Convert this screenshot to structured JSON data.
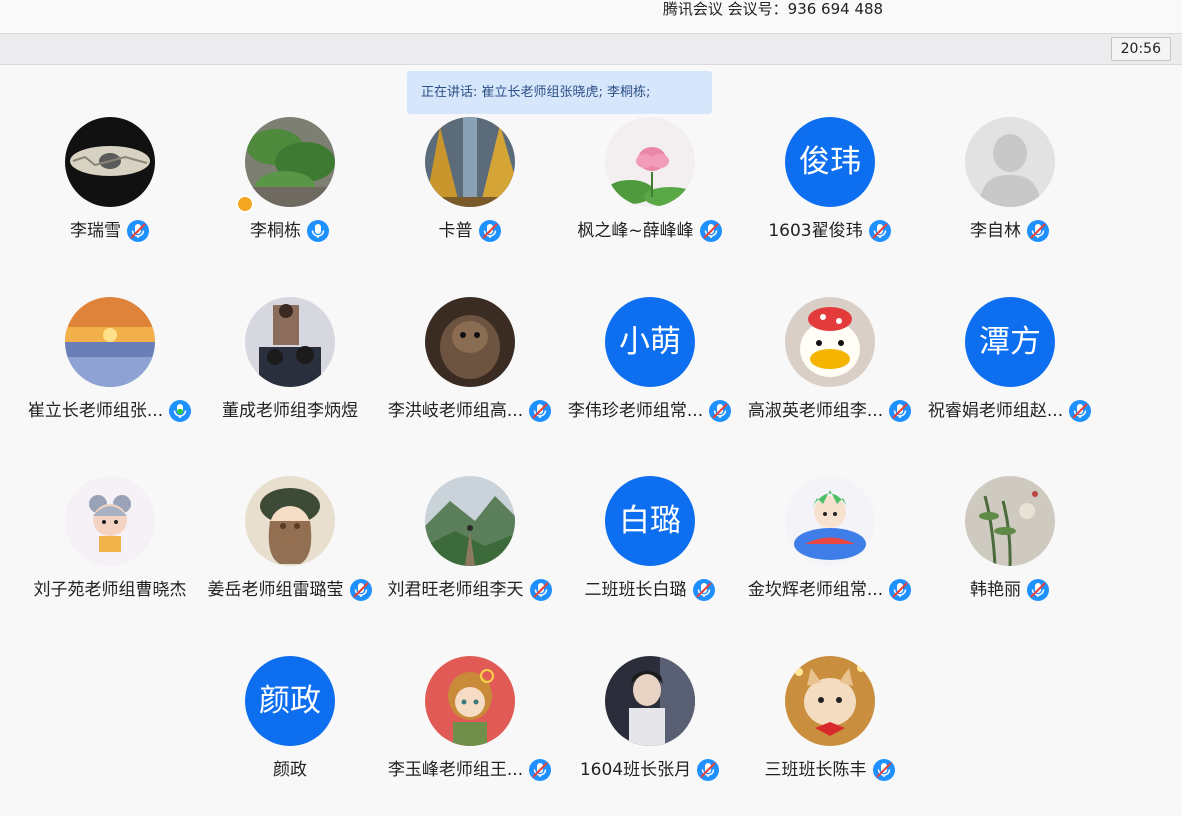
{
  "window": {
    "title": "腾讯会议 会议号：936 694 488"
  },
  "status_bar": {
    "clock": "20:56"
  },
  "speaking": {
    "text": "正在讲话: 崔立长老师组张晓虎; 李桐栋;"
  },
  "colors": {
    "accent": "#0d6ff0",
    "speaking_bg": "#d7e7fb",
    "mic_on": "#1e90ff"
  },
  "participants": [
    {
      "name": "李瑞雪",
      "avatar": "photo",
      "mic": "muted"
    },
    {
      "name": "李桐栋",
      "avatar": "photo",
      "mic": "on",
      "host": true
    },
    {
      "name": "卡普",
      "avatar": "photo",
      "mic": "muted"
    },
    {
      "name": "枫之峰~薛峰峰",
      "avatar": "photo",
      "mic": "muted"
    },
    {
      "name": "1603翟俊玮",
      "avatar_text": "俊玮",
      "mic": "muted"
    },
    {
      "name": "李自林",
      "avatar": "default",
      "mic": "muted"
    },
    {
      "name": "崔立长老师组张...",
      "avatar": "photo",
      "mic": "speaking"
    },
    {
      "name": "董成老师组李炳煜",
      "avatar": "photo",
      "mic": "none"
    },
    {
      "name": "李洪岐老师组高...",
      "avatar": "photo",
      "mic": "muted"
    },
    {
      "name": "李伟珍老师组常...",
      "avatar_text": "小萌",
      "mic": "muted"
    },
    {
      "name": "高淑英老师组李...",
      "avatar": "photo",
      "mic": "muted"
    },
    {
      "name": "祝睿娟老师组赵...",
      "avatar_text": "潭方",
      "mic": "muted"
    },
    {
      "name": "刘子苑老师组曹晓杰",
      "avatar": "photo",
      "mic": "none"
    },
    {
      "name": "姜岳老师组雷璐莹",
      "avatar": "photo",
      "mic": "muted"
    },
    {
      "name": "刘君旺老师组李天",
      "avatar": "photo",
      "mic": "muted"
    },
    {
      "name": "二班班长白璐",
      "avatar_text": "白璐",
      "mic": "muted"
    },
    {
      "name": "金坎辉老师组常...",
      "avatar": "photo",
      "mic": "muted"
    },
    {
      "name": "韩艳丽",
      "avatar": "photo",
      "mic": "muted"
    },
    {
      "name": "颜政",
      "avatar_text": "颜政",
      "mic": "none"
    },
    {
      "name": "李玉峰老师组王...",
      "avatar": "photo",
      "mic": "muted"
    },
    {
      "name": "1604班长张月",
      "avatar": "photo",
      "mic": "muted"
    },
    {
      "name": "三班班长陈丰",
      "avatar": "photo",
      "mic": "muted"
    }
  ]
}
